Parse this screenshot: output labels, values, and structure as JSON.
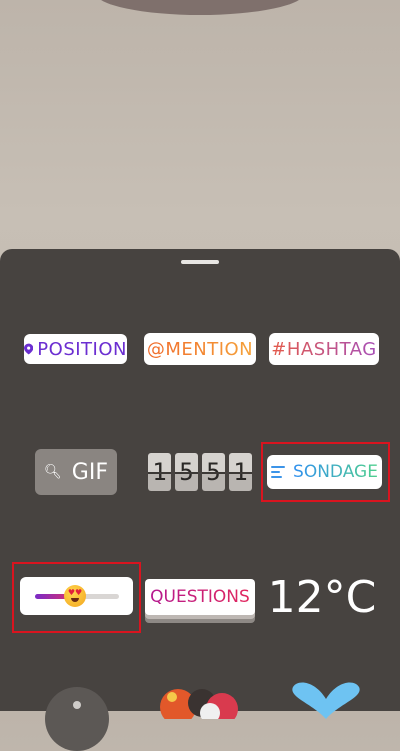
{
  "stickers": {
    "position": "POSITION",
    "mention": "@MENTION",
    "hashtag": "#HASHTAG",
    "gif": "GIF",
    "clock": [
      "1",
      "5",
      "5",
      "1"
    ],
    "poll": "SONDAGE",
    "questions": "QUESTIONS",
    "temperature": "12°C"
  },
  "colors": {
    "sheet": "#474340",
    "highlight": "#d9141f",
    "position_text": "#6b2ed1"
  },
  "icons": [
    "location-pin-icon",
    "search-icon",
    "poll-lines-icon",
    "heart-eyes-emoji-icon"
  ]
}
